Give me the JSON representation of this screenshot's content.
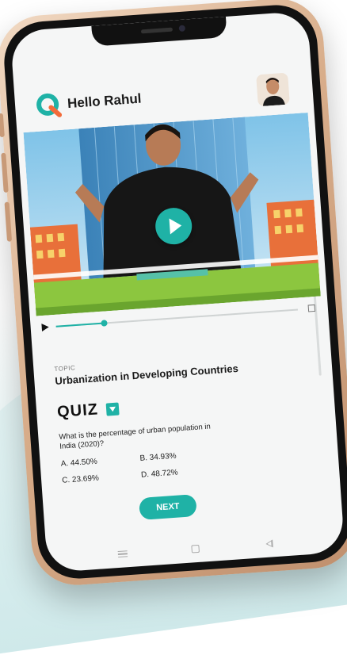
{
  "header": {
    "greeting": "Hello Rahul"
  },
  "video": {
    "progress": 0.2
  },
  "topic": {
    "label": "TOPIC",
    "title": "Urbanization in Developing Countries"
  },
  "quiz": {
    "title": "QUIZ",
    "question": "What is the percentage of urban population in India (2020)?",
    "options": [
      "A. 44.50%",
      "B. 34.93%",
      "C. 23.69%",
      "D. 48.72%"
    ],
    "next_label": "NEXT"
  },
  "colors": {
    "accent": "#1fb2a6",
    "frame": "#d8ad8a"
  },
  "icons": [
    "logo-icon",
    "play-icon",
    "fullscreen-icon",
    "dropdown-icon",
    "menu-icon",
    "home-icon",
    "back-icon"
  ]
}
